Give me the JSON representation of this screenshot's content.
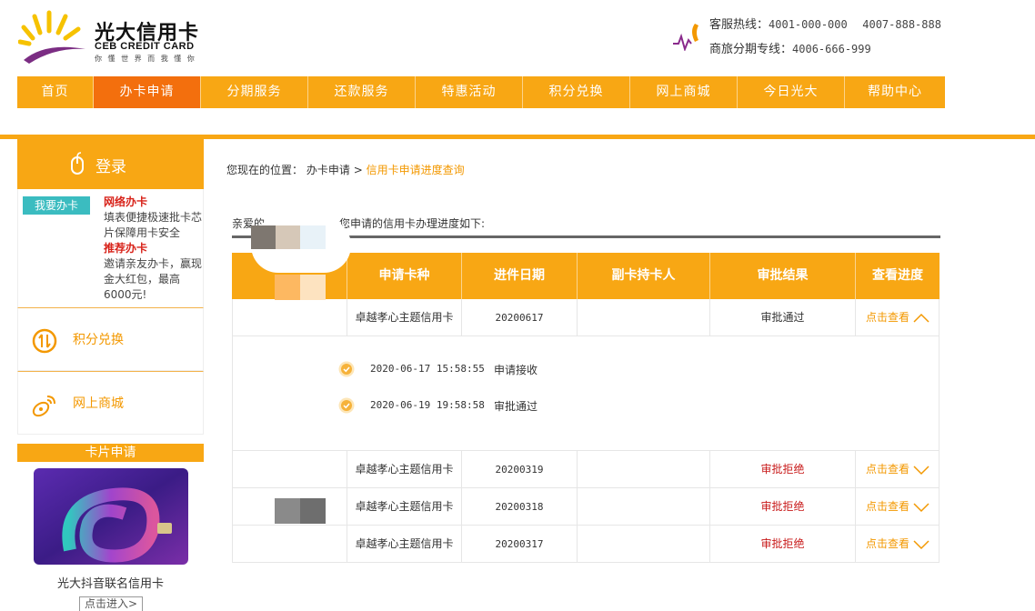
{
  "brand": {
    "name_cn": "光大信用卡",
    "name_en": "CEB CREDIT CARD",
    "slogan": "你 懂 世 界    而 我 懂 你"
  },
  "contact": {
    "hotline_label": "客服热线：",
    "hotline_1": "4001-000-000",
    "hotline_2": "4007-888-888",
    "travel_label": "商旅分期专线：",
    "travel_number": "4006-666-999"
  },
  "nav": {
    "items": [
      {
        "label": "首页"
      },
      {
        "label": "办卡申请"
      },
      {
        "label": "分期服务"
      },
      {
        "label": "还款服务"
      },
      {
        "label": "特惠活动"
      },
      {
        "label": "积分兑换"
      },
      {
        "label": "网上商城"
      },
      {
        "label": "今日光大"
      },
      {
        "label": "帮助中心"
      }
    ],
    "active_index": 1
  },
  "sidebar": {
    "login": "登录",
    "apply_tag": "我要办卡",
    "online_title": "网络办卡",
    "online_desc": "填表便捷极速批卡芯片保障用卡安全",
    "referral_title": "推荐办卡",
    "referral_desc": "邀请亲友办卡，赢现金大红包，最高6000元!",
    "points_label": "积分兑换",
    "mall_label": "网上商城",
    "card_header": "卡片申请",
    "card_name": "光大抖音联名信用卡",
    "card_button": "点击进入>"
  },
  "breadcrumb": {
    "prefix": "您现在的位置：",
    "parent": "办卡申请",
    "separator": ">",
    "current": "信用卡申请进度查询"
  },
  "greeting": {
    "start": "亲爱的",
    "end": "您申请的信用卡办理进度如下:"
  },
  "table": {
    "headers": [
      "",
      "申请卡种",
      "进件日期",
      "副卡持卡人",
      "审批结果",
      "查看进度"
    ],
    "rows": [
      {
        "card": "卓越孝心主题信用卡",
        "date": "20200617",
        "holder": "",
        "result": "审批通过",
        "status": "pass",
        "action": "点击查看",
        "expanded": true
      },
      {
        "card": "卓越孝心主题信用卡",
        "date": "20200319",
        "holder": "",
        "result": "审批拒绝",
        "status": "reject",
        "action": "点击查看",
        "expanded": false
      },
      {
        "card": "卓越孝心主题信用卡",
        "date": "20200318",
        "holder": "",
        "result": "审批拒绝",
        "status": "reject",
        "action": "点击查看",
        "expanded": false
      },
      {
        "card": "卓越孝心主题信用卡",
        "date": "20200317",
        "holder": "",
        "result": "审批拒绝",
        "status": "reject",
        "action": "点击查看",
        "expanded": false
      }
    ],
    "progress": [
      {
        "time": "2020-06-17 15:58:55",
        "status": "申请接收"
      },
      {
        "time": "2020-06-19 19:58:58",
        "status": "审批通过"
      }
    ]
  },
  "colors": {
    "primary": "#f8a714",
    "active": "#f36f0d",
    "link": "#f39800",
    "reject": "#c81a1a",
    "tag": "#3bbcc0"
  }
}
